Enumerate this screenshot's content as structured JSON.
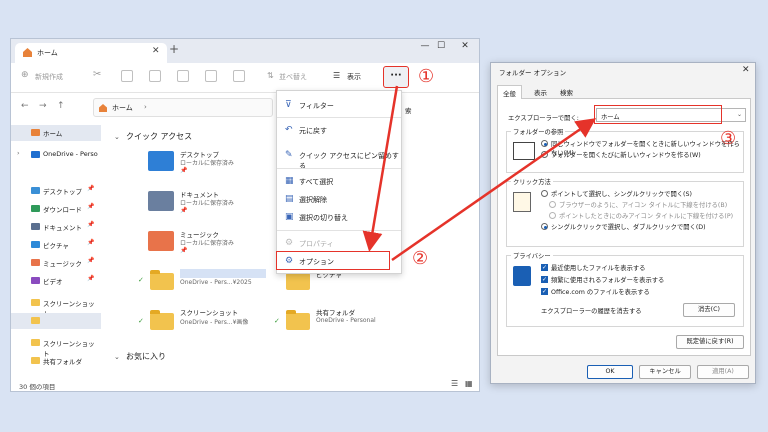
{
  "explorer": {
    "tab_title": "ホーム",
    "toolbar": {
      "new_label": "新規作成",
      "sort_label": "並べ替え",
      "view_label": "表示",
      "more_label": "···"
    },
    "address": "ホーム",
    "search_hint": "索",
    "sidebar": [
      {
        "label": "ホーム",
        "icon": "home-icon",
        "color": "#e8823a"
      },
      {
        "label": "OneDrive - Perso",
        "icon": "onedrive-icon",
        "color": "#1f6fd0"
      },
      {
        "label": "デスクトップ",
        "icon": "desktop-icon",
        "color": "#3a8fd6"
      },
      {
        "label": "ダウンロード",
        "icon": "download-icon",
        "color": "#2f9a5a"
      },
      {
        "label": "ドキュメント",
        "icon": "document-icon",
        "color": "#5a6f8f"
      },
      {
        "label": "ピクチャ",
        "icon": "pictures-icon",
        "color": "#2d89d8"
      },
      {
        "label": "ミュージック",
        "icon": "music-icon",
        "color": "#e8734a"
      },
      {
        "label": "ビデオ",
        "icon": "video-icon",
        "color": "#8a4bbf"
      },
      {
        "label": "スクリーンショット",
        "icon": "folder-icon",
        "color": "#f2c34e"
      },
      {
        "label": "",
        "icon": "folder-icon",
        "color": "#f2c34e"
      },
      {
        "label": "スクリーンショット",
        "icon": "folder-icon",
        "color": "#f2c34e"
      },
      {
        "label": "共有フォルダ",
        "icon": "folder-icon",
        "color": "#f2c34e"
      }
    ],
    "quick_access_title": "クイック アクセス",
    "favorites_title": "お気に入り",
    "items": [
      {
        "name": "デスクトップ",
        "sub": "ローカルに保存済み"
      },
      {
        "name": "ドキュメント",
        "sub": "ローカルに保存済み"
      },
      {
        "name": "ミュージック",
        "sub": "ローカルに保存済み"
      },
      {
        "name": "",
        "sub": "OneDrive - Pers...¥2025"
      },
      {
        "name": "スクリーンショット",
        "sub": "OneDrive - Pers...¥画像"
      },
      {
        "name": "共有フォルダ",
        "sub": "OneDrive - Personal"
      },
      {
        "name": "ピクチャ",
        "sub": ""
      }
    ],
    "status": "30 個の項目"
  },
  "menu": {
    "items": [
      {
        "label": "フィルター",
        "icon": "filter-icon",
        "disabled": false
      },
      {
        "label": "元に戻す",
        "icon": "undo-icon",
        "disabled": false
      },
      {
        "label": "クイック アクセスにピン留めする",
        "icon": "pin-icon",
        "disabled": false
      },
      {
        "label": "すべて選択",
        "icon": "select-all-icon",
        "disabled": false
      },
      {
        "label": "選択解除",
        "icon": "select-none-icon",
        "disabled": false
      },
      {
        "label": "選択の切り替え",
        "icon": "invert-selection-icon",
        "disabled": false
      },
      {
        "label": "プロパティ",
        "icon": "properties-icon",
        "disabled": true
      },
      {
        "label": "オプション",
        "icon": "options-gear-icon",
        "disabled": false
      }
    ]
  },
  "dialog": {
    "title": "フォルダー オプション",
    "tabs": [
      "全般",
      "表示",
      "検索"
    ],
    "open_explorer_label": "エクスプローラーで開く:",
    "open_explorer_value": "ホーム",
    "browse_group": "フォルダーの参照",
    "browse_opt1": "同じウィンドウでフォルダーを開くときに新しいウィンドウを作らない(M)",
    "browse_opt2": "フォルダーを開くたびに新しいウィンドウを作る(W)",
    "click_group": "クリック方法",
    "click_opt1": "ポイントして選択し、シングルクリックで開く(S)",
    "click_opt1a": "ブラウザーのように、アイコン タイトルに下線を付ける(B)",
    "click_opt1b": "ポイントしたときにのみアイコン タイトルに下線を付ける(P)",
    "click_opt2": "シングルクリックで選択し、ダブルクリックで開く(D)",
    "privacy_group": "プライバシー",
    "privacy_opt1": "最近使用したファイルを表示する",
    "privacy_opt2": "頻繁に使用されるフォルダーを表示する",
    "privacy_opt3": "Office.com のファイルを表示する",
    "clear_history_label": "エクスプローラーの履歴を消去する",
    "clear_button": "消去(C)",
    "restore_button": "既定値に戻す(R)",
    "ok_button": "OK",
    "cancel_button": "キャンセル",
    "apply_button": "適用(A)"
  },
  "annotations": {
    "n1": "①",
    "n2": "②",
    "n3": "③"
  },
  "colors": {
    "accent": "#e5332a",
    "folder": "#f2c34e",
    "selection": "#1a5fb4"
  }
}
